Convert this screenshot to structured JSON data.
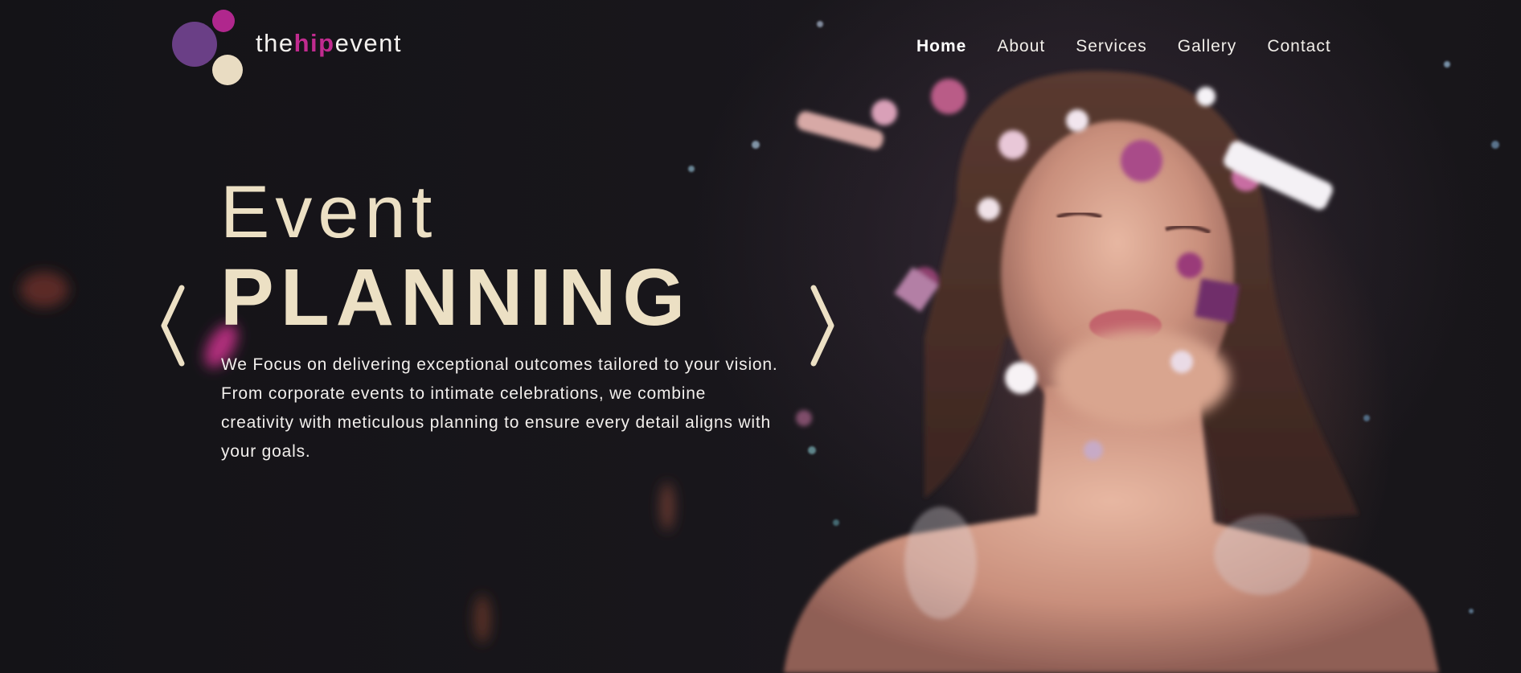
{
  "brand": {
    "prefix": "the",
    "highlight": "hip",
    "suffix": "event",
    "colors": {
      "purple": "#6a3f86",
      "magenta": "#b0278d",
      "cream": "#e9dcc2"
    }
  },
  "nav": {
    "items": [
      {
        "label": "Home",
        "active": true
      },
      {
        "label": "About",
        "active": false
      },
      {
        "label": "Services",
        "active": false
      },
      {
        "label": "Gallery",
        "active": false
      },
      {
        "label": "Contact",
        "active": false
      }
    ]
  },
  "hero": {
    "title_light": "Event",
    "title_bold": "PLANNING",
    "description": "We Focus on delivering exceptional outcomes tailored to your vision. From corporate events to intimate celebrations, we combine creativity with meticulous planning to ensure every detail aligns with your goals.",
    "prev_icon": "chevron-left-icon",
    "next_icon": "chevron-right-icon",
    "accent_color": "#ece0c4"
  }
}
